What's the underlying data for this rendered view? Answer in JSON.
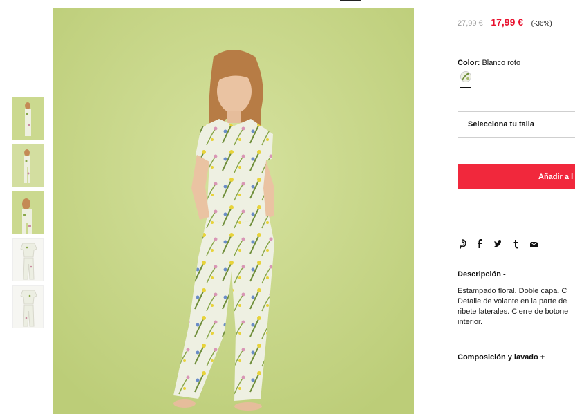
{
  "product": {
    "old_price": "27,99 €",
    "new_price": "17,99 €",
    "discount": "(-36%)",
    "color_label": "Color:",
    "color_value": "Blanco roto",
    "size_placeholder": "Selecciona tu talla",
    "add_button": "Añadir a l",
    "description_title": "Descripción -",
    "description_lines": [
      "Estampado floral. Doble capa. C",
      "Detalle de volante en la parte de",
      "ribete laterales. Cierre de botone",
      "interior."
    ],
    "composition_title": "Composición y lavado +"
  },
  "share": {
    "icons": [
      "pinterest-icon",
      "facebook-icon",
      "twitter-icon",
      "tumblr-icon",
      "email-icon"
    ]
  },
  "gallery": {
    "thumbnails": [
      "green",
      "green",
      "green",
      "white",
      "white"
    ]
  },
  "colors": {
    "price_red": "#e8132f",
    "button_red": "#f1283c",
    "background_green": "#c9d98a"
  }
}
